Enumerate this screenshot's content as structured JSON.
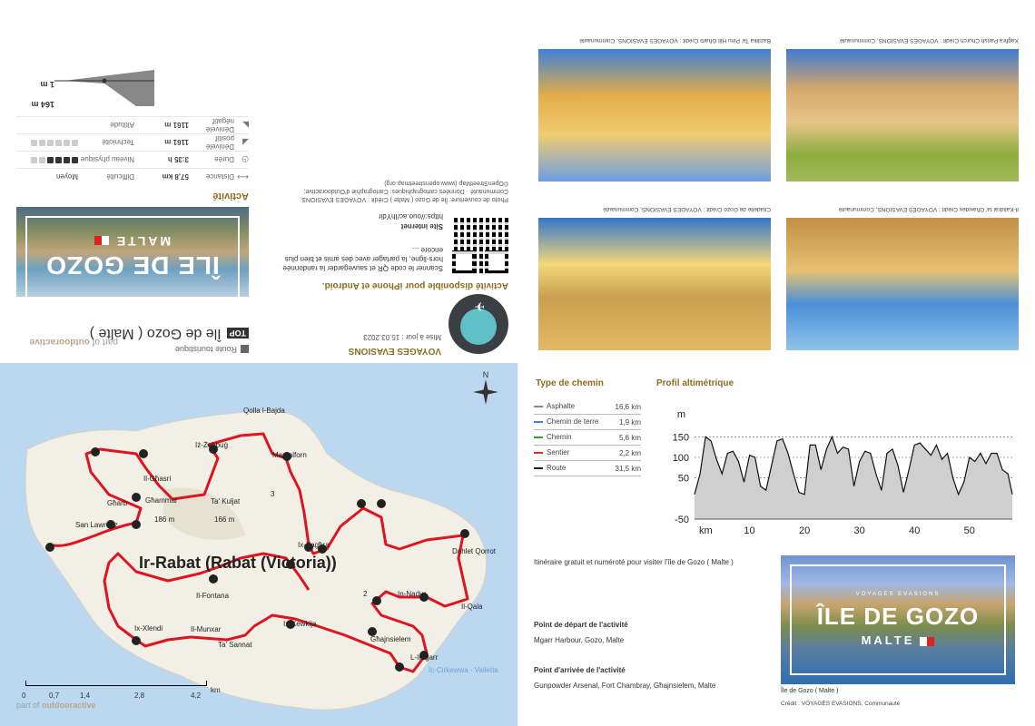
{
  "top_left": {
    "brand_prefix": "part of",
    "brand_name": "outdooractive",
    "tag": "Route touristique",
    "top_badge": "TOP",
    "title": "Île de Gozo ( Malte )",
    "cover_title": "ÎLE DE GOZO",
    "cover_sub": "MALTE",
    "activity_heading": "Activité",
    "stats": [
      {
        "icon": "arrow-icon",
        "label": "Distance",
        "value": "57,8 km",
        "extra_label": "Difficulté",
        "extra_value": "Moyen"
      },
      {
        "icon": "clock-icon",
        "label": "Durée",
        "value": "3:35 h",
        "extra_label": "Niveau physique",
        "dots_on": 4,
        "dots_total": 6
      },
      {
        "icon": "up-icon",
        "label": "Dénivelé positif",
        "value": "1161 m",
        "extra_label": "Technicité",
        "dots_on": 0,
        "dots_total": 6
      },
      {
        "icon": "down-icon",
        "label": "Dénivelé négatif",
        "value": "1161 m",
        "extra_label": "Altitude"
      }
    ],
    "alt_high": "164 m",
    "alt_low": "1 m",
    "voyages": "VOYAGES EVASIONS",
    "update": "Mise à jour : 15.03.2023",
    "app_heading": "Activité disponible pour iPhone et Android.",
    "app_text": "Scanner le code QR et sauvegarder la randonnée hors-ligne, la partager avec des amis et bien plus encore ...",
    "site_heading": "Site internet",
    "site_url": "https://ouo.ac/IhYdir",
    "credits": "Photo de couverture: Île de Gozo ( Malte ) Crédit : VOYAGES EVASIONS, Communauté · Données cartographiques: Cartographie d'Outdooractive; ©OpenStreetMap (www.openstreetmap.org)"
  },
  "photos": [
    {
      "caption": "Il-Katidral ta' Għawdex Crédit : VOYAGES EVASIONS, Communauté"
    },
    {
      "caption": "Citadelle de Gozo Crédit : VOYAGES EVASIONS, Communauté"
    },
    {
      "caption": "Xagħra Parish Church Crédit : VOYAGES EVASIONS, Communauté"
    },
    {
      "caption": "Bażilika Ta' Pinu Hill Għarb Crédit : VOYAGES EVASIONS, Communauté"
    }
  ],
  "map": {
    "labels": [
      "Qolla l-Bajda",
      "Iż-Żebbuġ",
      "Marsalforn",
      "Il-Għasri",
      "Għarb",
      "Għammar",
      "186 m",
      "Ta' Kuljat",
      "166 m",
      "San Lawrenz",
      "Ix-Xagħra",
      "Dahlet Qorrot",
      "In-Nadur",
      "Il-Qala",
      "Il-Fontana",
      "Ix-Xlendi",
      "Il-Munxar",
      "Ta' Sannat",
      "Ix-Xewkija",
      "Għajnsielem",
      "L-Imġarr",
      "2",
      "3"
    ],
    "capital": "Ir-Rabat (Rabat (Victoria))",
    "compass": "N",
    "scale": [
      "0",
      "0,7",
      "1,4",
      "2,8",
      "4,2",
      "km"
    ],
    "brand_prefix": "part of",
    "brand_name": "outdooractive",
    "ferry": "Ic-Cirkewwa - Valletta"
  },
  "legend_heading": "Type de chemin",
  "legend": [
    {
      "name": "Asphalte",
      "value": "16,6 km",
      "color": "#888888"
    },
    {
      "name": "Chemin de terre",
      "value": "1,9 km",
      "color": "#4a7fd0"
    },
    {
      "name": "Chemin",
      "value": "5,6 km",
      "color": "#3a9b3a"
    },
    {
      "name": "Sentier",
      "value": "2,2 km",
      "color": "#d83030"
    },
    {
      "name": "Route",
      "value": "31,5 km",
      "color": "#222222"
    }
  ],
  "profile_heading": "Profil altimétrique",
  "chart_data": {
    "type": "area",
    "title": "Profil altimétrique",
    "xlabel": "km",
    "ylabel": "m",
    "xlim": [
      0,
      57.8
    ],
    "ylim": [
      -50,
      175
    ],
    "x_ticks": [
      "10",
      "20",
      "30",
      "40",
      "50"
    ],
    "y_ticks": [
      "150",
      "100",
      "50",
      "-50"
    ],
    "x": [
      0,
      1,
      2,
      3,
      4,
      5,
      6,
      7,
      8,
      9,
      10,
      11,
      12,
      13,
      14,
      15,
      16,
      17,
      18,
      19,
      20,
      21,
      22,
      23,
      24,
      25,
      26,
      27,
      28,
      29,
      30,
      31,
      32,
      33,
      34,
      35,
      36,
      37,
      38,
      39,
      40,
      41,
      42,
      43,
      44,
      45,
      46,
      47,
      48,
      49,
      50,
      51,
      52,
      53,
      54,
      55,
      56,
      57,
      57.8
    ],
    "y": [
      10,
      60,
      150,
      140,
      95,
      60,
      110,
      115,
      90,
      40,
      105,
      100,
      30,
      20,
      80,
      140,
      145,
      110,
      60,
      15,
      10,
      130,
      130,
      70,
      120,
      150,
      110,
      125,
      120,
      30,
      90,
      115,
      110,
      60,
      20,
      110,
      120,
      80,
      15,
      70,
      130,
      135,
      120,
      105,
      130,
      95,
      110,
      50,
      10,
      40,
      100,
      90,
      110,
      85,
      110,
      110,
      70,
      60,
      10
    ]
  },
  "description": "Itinéraire gratuit et numéroté pour visiter l'île de Gozo ( Malte )",
  "start_heading": "Point de départ de l'activité",
  "start_value": "Mgarr Harbour, Gozo, Malte",
  "end_heading": "Point d'arrivée de l'activité",
  "end_value": "Gunpowder Arsenal, Fort Chambray, Għajnsielem, Malte",
  "cover2_vt": "VOYAGES EVASIONS",
  "cover2_title": "ÎLE DE GOZO",
  "cover2_sub": "MALTE",
  "cover2_caption": "Île de Gozo ( Malte )",
  "cover2_credit": "Crédit : VOYAGES EVASIONS, Communauté"
}
